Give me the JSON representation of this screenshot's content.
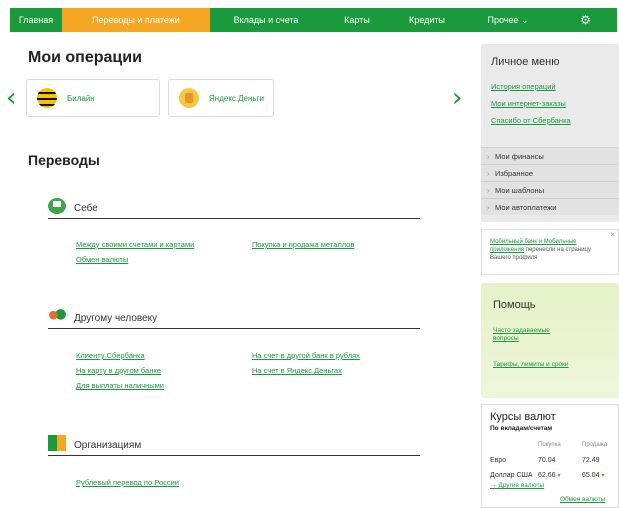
{
  "nav": {
    "items": [
      "Главная",
      "Переводы и платежи",
      "Вклады и счета",
      "Карты",
      "Кредиты",
      "Прочее ⌄"
    ],
    "active_index": 1,
    "settings_icon": "gear-icon"
  },
  "colors": {
    "brand_green": "#1a9a3c",
    "accent_orange": "#f5a623"
  },
  "operations": {
    "title": "Мои операции",
    "cards": [
      "Билайн",
      "Яндекс.Деньги"
    ],
    "prev_icon": "chevron-left-icon",
    "next_icon": "chevron-right-icon"
  },
  "transfers": {
    "title": "Переводы",
    "groups": [
      {
        "label": "Себе",
        "icon": "wallet-icon",
        "links": [
          "Между своими счетами и картами",
          "Обмен валюты",
          "Покупка и продажа металлов"
        ]
      },
      {
        "label": "Другому человеку",
        "icon": "people-icon",
        "links": [
          "Клиенту Сбербанка",
          "На карту в другом банке",
          "Для выплаты наличными",
          "На счет в другой банк в рублях",
          "На счет в Яндекс.Деньгах"
        ]
      },
      {
        "label": "Организациям",
        "icon": "building-icon",
        "links": [
          "Рублевый перевод по России"
        ]
      }
    ]
  },
  "sidebar": {
    "menu_title": "Личное меню",
    "menu_links": [
      "История операций",
      "Мои интернет-заказы",
      "Спасибо от Сбербанка"
    ],
    "menu_sections": [
      "Мои финансы",
      "Избранное",
      "Мои шаблоны",
      "Мои автоплатежи"
    ],
    "promo": {
      "link": "Мобильный банк и Мобильные приложения",
      "text": "перенесли на страницу Вашего профиля"
    },
    "help": {
      "title": "Помощь",
      "links": [
        "Часто задаваемые вопросы",
        "Тарифы, лимиты и сроки"
      ]
    },
    "rates": {
      "title": "Курсы валют",
      "subtitle": "По вкладам/счетам",
      "col_buy": "Покупка",
      "col_sell": "Продажа",
      "rows": [
        {
          "name": "Евро",
          "buy": "70.04",
          "sell": "72.49",
          "buy_down": false,
          "sell_down": false
        },
        {
          "name": "Доллар США",
          "buy": "62.66",
          "sell": "65.04",
          "buy_down": true,
          "sell_down": true
        }
      ],
      "other_link": "Другие валюты",
      "exchange_link": "Обмен валюты"
    }
  }
}
